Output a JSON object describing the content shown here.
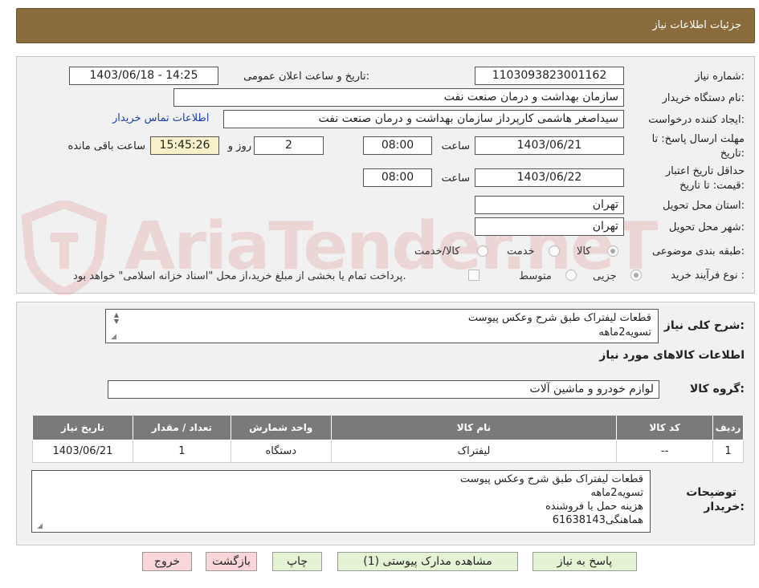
{
  "header": {
    "title": "جزئیات اطلاعات نیاز"
  },
  "watermark": {
    "text": "AriaTender.neT"
  },
  "form": {
    "need_number_label": "شماره نیاز:",
    "need_number": "1103093823001162",
    "announce_label": "تاریخ و ساعت اعلان عمومی:",
    "announce_value": "1403/06/18 - 14:25",
    "buyer_org_label": "نام دستگاه خریدار:",
    "buyer_org": "سازمان بهداشت و درمان صنعت نفت",
    "requester_label": "ایجاد کننده درخواست:",
    "requester": "سیداصغر هاشمی کارپرداز سازمان بهداشت و درمان صنعت نفت",
    "contact_link": "اطلاعات تماس خریدار",
    "deadline_label_1": "مهلت ارسال پاسخ: تا",
    "deadline_label_2": "تاریخ:",
    "deadline_date": "1403/06/21",
    "time_word": "ساعت",
    "deadline_time": "08:00",
    "days_count": "2",
    "days_word": "روز و",
    "remaining_time": "15:45:26",
    "remaining_word": "ساعت باقی مانده",
    "validity_label_1": "حداقل تاریخ اعتبار",
    "validity_label_2": "قیمت: تا تاریخ:",
    "validity_date": "1403/06/22",
    "validity_time": "08:00",
    "province_label": "استان محل تحویل:",
    "province": "تهران",
    "city_label": "شهر محل تحویل:",
    "city": "تهران",
    "category_label": "طبقه بندی موضوعی:",
    "category_options": [
      "کالا",
      "خدمت",
      "کالا/خدمت"
    ],
    "process_label": "نوع فرآیند خرید :",
    "process_options": [
      "جزیی",
      "متوسط"
    ],
    "payment_note": "پرداخت تمام یا بخشی از مبلغ خرید،از محل \"اسناد خزانه اسلامی\" خواهد بود."
  },
  "summary": {
    "label": "شرح کلی نیاز:",
    "lines": [
      "قطعات لیفتراک طبق شرح وعکس پیوست",
      "تسویه2ماهه"
    ],
    "goods_info_title": "اطلاعات کالاهای مورد نیاز",
    "group_label": "گروه کالا:",
    "group_value": "لوازم خودرو و ماشین آلات"
  },
  "table": {
    "headers": [
      "ردیف",
      "کد کالا",
      "نام کالا",
      "واحد شمارش",
      "تعداد / مقدار",
      "تاریخ نیاز"
    ],
    "rows": [
      [
        "1",
        "--",
        "لیفتراک",
        "دستگاه",
        "1",
        "1403/06/21"
      ]
    ]
  },
  "buyer_notes": {
    "label_1": "توضیحات",
    "label_2": "خریدار:",
    "lines": [
      "قطعات لیفتراک طبق شرح وعکس پیوست",
      "تسویه2ماهه",
      "هزینه حمل با فروشنده",
      "هماهنگی61638143"
    ]
  },
  "buttons": {
    "reply": "پاسخ به نیاز",
    "attachments": "مشاهده مدارک پیوستی (1)",
    "print": "چاپ",
    "back": "بازگشت",
    "exit": "خروج"
  }
}
